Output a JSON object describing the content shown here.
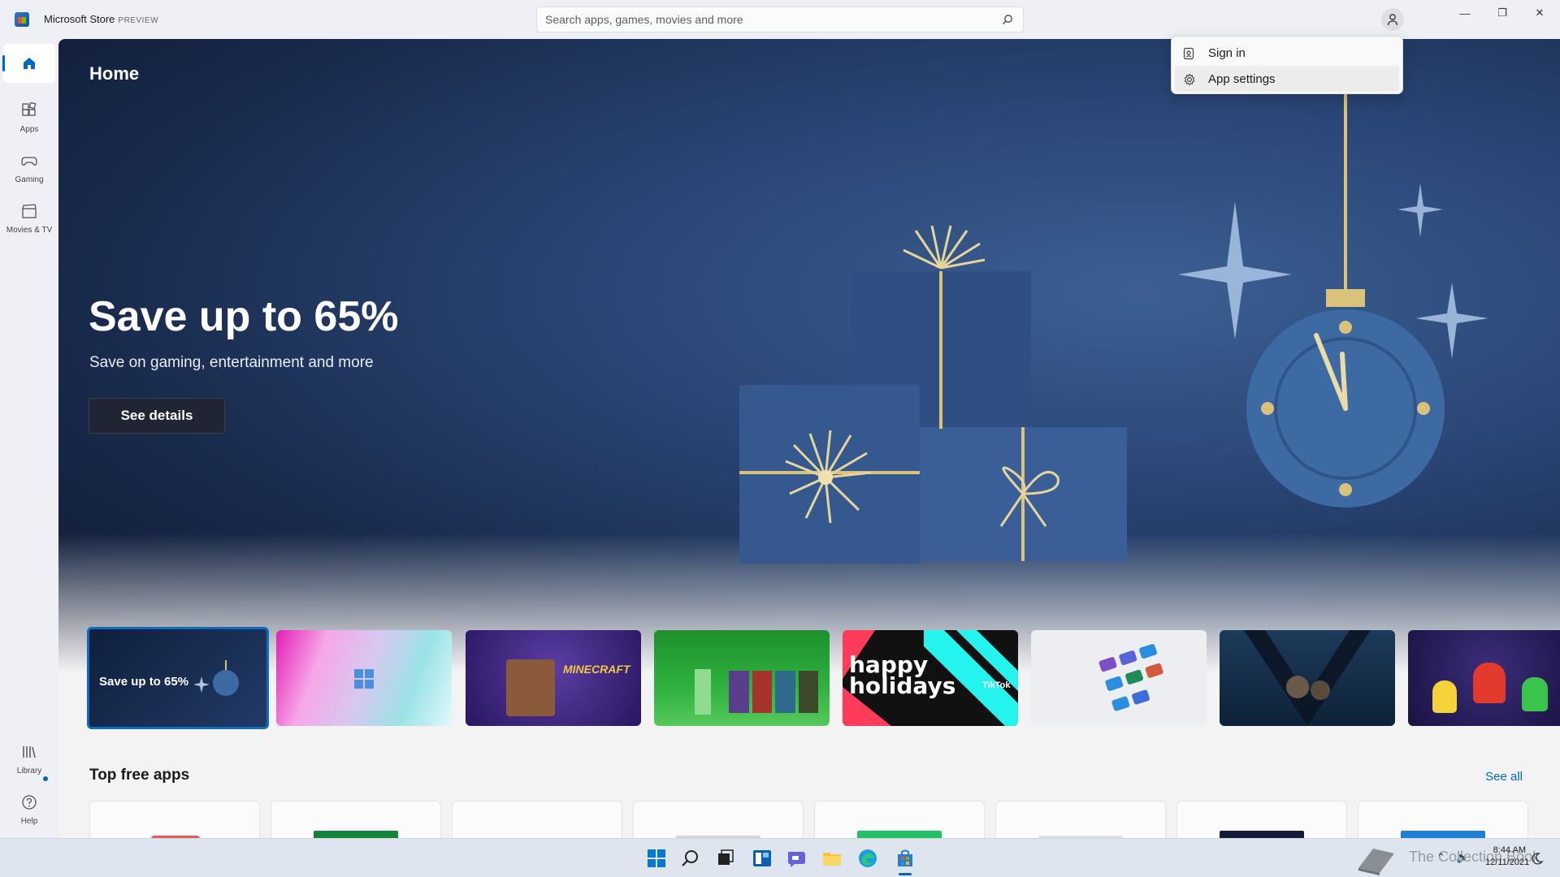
{
  "window": {
    "app_title": "Microsoft Store",
    "app_badge": "PREVIEW",
    "search_placeholder": "Search apps, games, movies and more",
    "controls": {
      "minimize": "—",
      "maximize": "❐",
      "close": "✕"
    }
  },
  "sidebar": {
    "items": [
      {
        "label": "",
        "icon": "home-icon",
        "active": true
      },
      {
        "label": "Apps",
        "icon": "apps-icon"
      },
      {
        "label": "Gaming",
        "icon": "controller-icon"
      },
      {
        "label": "Movies & TV",
        "icon": "film-icon"
      },
      {
        "label": "Library",
        "icon": "library-icon",
        "badge": true
      },
      {
        "label": "Help",
        "icon": "help-icon"
      }
    ]
  },
  "account_menu": {
    "items": [
      {
        "label": "Sign in",
        "icon": "badge-icon"
      },
      {
        "label": "App settings",
        "icon": "gear-icon"
      }
    ]
  },
  "main": {
    "page_title": "Home",
    "hero": {
      "title": "Save up to 65%",
      "subtitle": "Save on gaming, entertainment and more",
      "button": "See details"
    },
    "carousel": {
      "tile1_label": "Save up to 65%",
      "tile3_label": "MINECRAFT",
      "tile5_label": "happy holidays",
      "tile5_brand": "TikTok"
    },
    "section": {
      "title": "Top free apps",
      "see_all": "See all"
    }
  },
  "taskbar": {
    "time": "8:44 AM",
    "date": "12/11/2021",
    "watermark": "The Collection Book"
  },
  "colors": {
    "accent": "#0067c0",
    "hero_dark": "#0e1830",
    "hero_mid": "#2a4676",
    "gold": "#d9c27a"
  }
}
